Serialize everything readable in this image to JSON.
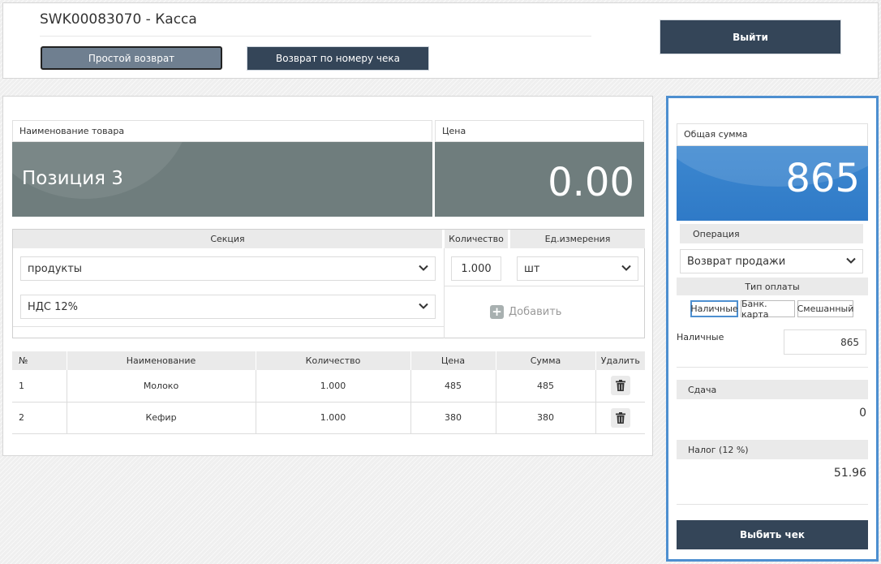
{
  "header": {
    "title": "SWK00083070 - Касса",
    "simple_return_label": "Простой возврат",
    "receipt_return_label": "Возврат по номеру чека",
    "exit_label": "Выйти"
  },
  "product": {
    "name_header": "Наименование товара",
    "price_header": "Цена",
    "name_value": "Позиция 3",
    "price_value": "0.00"
  },
  "form": {
    "section_header": "Секция",
    "quantity_header": "Количество",
    "unit_header": "Ед.измерения",
    "section_value": "продукты",
    "quantity_value": "1.000",
    "unit_value": "шт",
    "vat_value": "НДС 12%",
    "add_label": "Добавить"
  },
  "table": {
    "headers": [
      "№",
      "Наименование",
      "Количество",
      "Цена",
      "Сумма",
      "Удалить"
    ],
    "rows": [
      {
        "num": "1",
        "name": "Молоко",
        "qty": "1.000",
        "price": "485",
        "sum": "485"
      },
      {
        "num": "2",
        "name": "Кефир",
        "qty": "1.000",
        "price": "380",
        "sum": "380"
      }
    ]
  },
  "summary": {
    "total_label": "Общая сумма",
    "total_value": "865",
    "operation_label": "Операция",
    "operation_value": "Возврат продажи",
    "payment_type_label": "Тип оплаты",
    "payment_types": [
      "Наличные",
      "Банк. карта",
      "Смешанный"
    ],
    "selected_payment": "Наличные",
    "cash_label": "Наличные",
    "cash_value": "865",
    "change_label": "Сдача",
    "change_value": "0",
    "tax_label": "Налог (12 %)",
    "tax_value": "51.96",
    "print_label": "Выбить чек"
  },
  "colors": {
    "dark_button": "#344558",
    "display_gray": "#6f7d7d",
    "display_blue": "#3d88d0",
    "panel_border": "#4d8fd0"
  },
  "icons": {
    "delete": "trash-icon",
    "dropdown": "chevron-down-icon",
    "add": "plus-icon"
  }
}
